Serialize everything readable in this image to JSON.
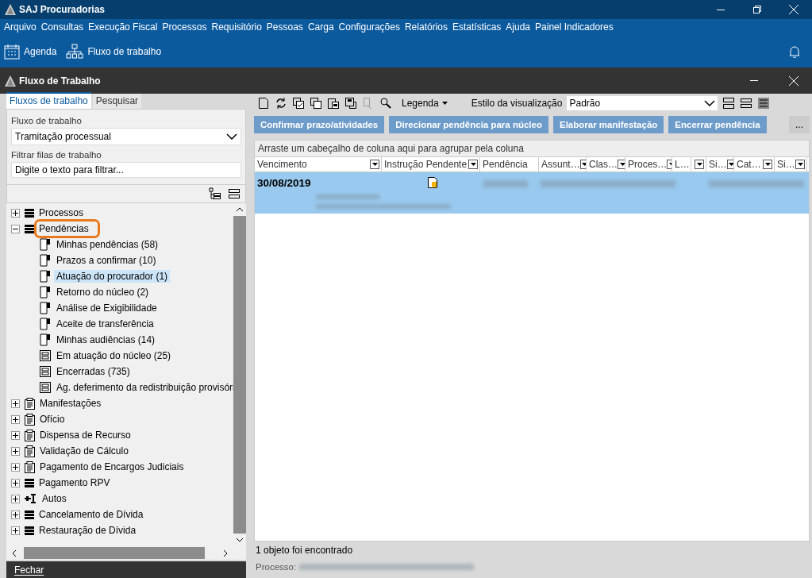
{
  "window": {
    "title": "SAJ Procuradorias"
  },
  "menu": [
    "Arquivo",
    "Consultas",
    "Execução Fiscal",
    "Processos",
    "Requisitório",
    "Pessoas",
    "Carga",
    "Configurações",
    "Relatórios",
    "Estatísticas",
    "Ajuda",
    "Painel Indicadores"
  ],
  "toolbar": [
    {
      "label": "Agenda",
      "kind": "calendar"
    },
    {
      "label": "Fluxo de trabalho",
      "kind": "hierarchy"
    }
  ],
  "subwindow": {
    "title": "Fluxo de Trabalho"
  },
  "left_tabs": [
    {
      "label": "Fluxos de trabalho",
      "selected": true
    },
    {
      "label": "Pesquisar",
      "selected": false
    }
  ],
  "workflow": {
    "label": "Fluxo de trabalho",
    "value": "Tramitação processual"
  },
  "filter": {
    "label": "Filtrar filas de trabalho",
    "placeholder": "Digite o texto para filtrar..."
  },
  "tree": [
    {
      "label": "Processos",
      "kind": "stack",
      "expanded": false,
      "highlighted": false
    },
    {
      "label": "Pendências",
      "kind": "stack",
      "expanded": true,
      "highlighted": true,
      "children": [
        {
          "label": "Minhas pendências (58)",
          "kind": "flag",
          "selected": false
        },
        {
          "label": "Prazos a confirmar (10)",
          "kind": "flag",
          "selected": false
        },
        {
          "label": "Atuação do procurador (1)",
          "kind": "flag",
          "selected": true
        },
        {
          "label": "Retorno do núcleo (2)",
          "kind": "flag",
          "selected": false
        },
        {
          "label": "Análise de Exigibilidade",
          "kind": "flag",
          "selected": false
        },
        {
          "label": "Aceite de transferência",
          "kind": "flag",
          "selected": false
        },
        {
          "label": "Minhas audiências (14)",
          "kind": "flag",
          "selected": false
        },
        {
          "label": "Em atuação do núcleo (25)",
          "kind": "form",
          "selected": false
        },
        {
          "label": "Encerradas (735)",
          "kind": "form",
          "selected": false
        },
        {
          "label": "Ag. deferimento da redistribuição provisóri",
          "kind": "form",
          "selected": false
        }
      ]
    },
    {
      "label": "Manifestações",
      "kind": "clipboard",
      "expanded": false,
      "highlighted": false
    },
    {
      "label": "Ofício",
      "kind": "clipboard",
      "expanded": false,
      "highlighted": false
    },
    {
      "label": "Dispensa de Recurso",
      "kind": "clipboard",
      "expanded": false,
      "highlighted": false
    },
    {
      "label": "Validação de Cálculo",
      "kind": "clipboard",
      "expanded": false,
      "highlighted": false
    },
    {
      "label": "Pagamento de Encargos Judiciais",
      "kind": "clipboard",
      "expanded": false,
      "highlighted": false
    },
    {
      "label": "Pagamento RPV",
      "kind": "stack",
      "expanded": false,
      "highlighted": false
    },
    {
      "label": "Autos",
      "kind": "autos",
      "expanded": false,
      "highlighted": false
    },
    {
      "label": "Cancelamento de Dívida",
      "kind": "stack",
      "expanded": false,
      "highlighted": false
    },
    {
      "label": "Restauração de Dívida",
      "kind": "stack",
      "expanded": false,
      "highlighted": false
    }
  ],
  "close_button": "Fechar",
  "legend": "Legenda",
  "view_style": {
    "label": "Estilo da visualização",
    "value": "Padrão"
  },
  "actions": [
    "Confirmar prazo/atividades",
    "Direcionar pendência para núcleo",
    "Elaborar manifestação",
    "Encerrar pendência"
  ],
  "more_button": "...",
  "group_hint": "Arraste um cabeçalho de coluna aqui para agrupar pela coluna",
  "table": {
    "columns": [
      {
        "label": "Vencimento",
        "filter": true
      },
      {
        "label": "Instrução Pendente",
        "filter": true
      },
      {
        "label": "Pendência",
        "filter": false
      },
      {
        "label": "Assunt…",
        "filter": true
      },
      {
        "label": "Clas…",
        "filter": true
      },
      {
        "label": "Proces…",
        "filter": true
      },
      {
        "label": "L…",
        "filter": false
      },
      {
        "filter": true
      },
      {
        "label": "Si…",
        "filter": true
      },
      {
        "label": "Cat…",
        "filter": true
      },
      {
        "label": "Si…",
        "filter": true
      }
    ],
    "rows": [
      {
        "due": "30/08/2019",
        "selected": true
      }
    ]
  },
  "status": "1 objeto foi encontrado",
  "process_label": "Processo:"
}
